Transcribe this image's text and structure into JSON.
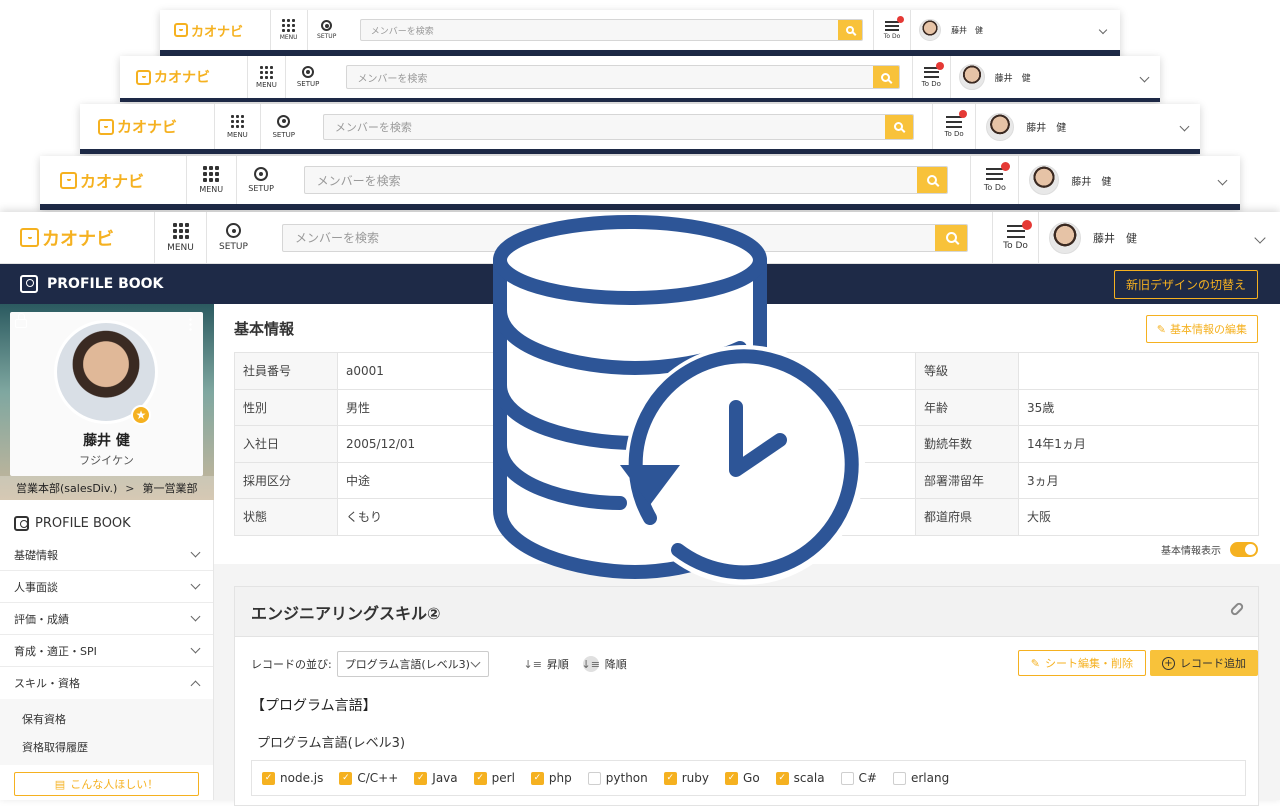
{
  "header": {
    "logo_text": "カオナビ",
    "menu_label": "MENU",
    "setup_label": "SETUP",
    "search_placeholder": "メンバーを検索",
    "todo_label": "To Do",
    "user_name": "藤井　健"
  },
  "navbar": {
    "title": "PROFILE BOOK",
    "switch_button": "新旧デザインの切替え"
  },
  "profile": {
    "name": "藤井 健",
    "kana": "フジイケン",
    "dept_path": [
      "営業本部(salesDiv.)",
      "第一営業部"
    ]
  },
  "sidebar": {
    "heading": "PROFILE BOOK",
    "items": [
      {
        "label": "基礎情報",
        "expanded": false
      },
      {
        "label": "人事面談",
        "expanded": false
      },
      {
        "label": "評価・成績",
        "expanded": false
      },
      {
        "label": "育成・適正・SPI",
        "expanded": false
      },
      {
        "label": "スキル・資格",
        "expanded": true
      }
    ],
    "sub_items": [
      "保有資格",
      "資格取得履歴"
    ],
    "want_button": "こんな人ほしい！"
  },
  "basic_info": {
    "title": "基本情報",
    "edit_button": "基本情報の編集",
    "rows": [
      {
        "l1": "社員番号",
        "v1": "a0001",
        "l2": "等級",
        "v2": ""
      },
      {
        "l1": "性別",
        "v1": "男性",
        "l2": "年齢",
        "v2": "35歳"
      },
      {
        "l1": "入社日",
        "v1": "2005/12/01",
        "l2": "勤続年数",
        "v2": "14年1ヵ月"
      },
      {
        "l1": "採用区分",
        "v1": "中途",
        "l2": "部署滞留年",
        "v2": "3ヵ月"
      },
      {
        "l1": "状態",
        "v1": "くもり",
        "l2": "都道府県",
        "v2": "大阪"
      }
    ],
    "toggle_label": "基本情報表示",
    "toggle_on": true
  },
  "skill_sheet": {
    "title": "エンジニアリングスキル②",
    "record_order_label": "レコードの並び:",
    "record_order_value": "プログラム言語(レベル3)",
    "asc_label": "昇順",
    "desc_label": "降順",
    "sheet_edit_button": "シート編集・削除",
    "add_record_button": "レコード追加",
    "category": "【プログラム言語】",
    "subcategory": "プログラム言語(レベル3)",
    "languages": [
      {
        "name": "node.js",
        "checked": true
      },
      {
        "name": "C/C++",
        "checked": true
      },
      {
        "name": "Java",
        "checked": true
      },
      {
        "name": "perl",
        "checked": true
      },
      {
        "name": "php",
        "checked": true
      },
      {
        "name": "python",
        "checked": false
      },
      {
        "name": "ruby",
        "checked": true
      },
      {
        "name": "Go",
        "checked": true
      },
      {
        "name": "scala",
        "checked": true
      },
      {
        "name": "C#",
        "checked": false
      },
      {
        "name": "erlang",
        "checked": false
      }
    ]
  },
  "overlay_icon": "database-history-icon",
  "colors": {
    "accent": "#f5b120",
    "navbar": "#1e2a47",
    "overlay": "#2d5597",
    "notification": "#e53935"
  }
}
